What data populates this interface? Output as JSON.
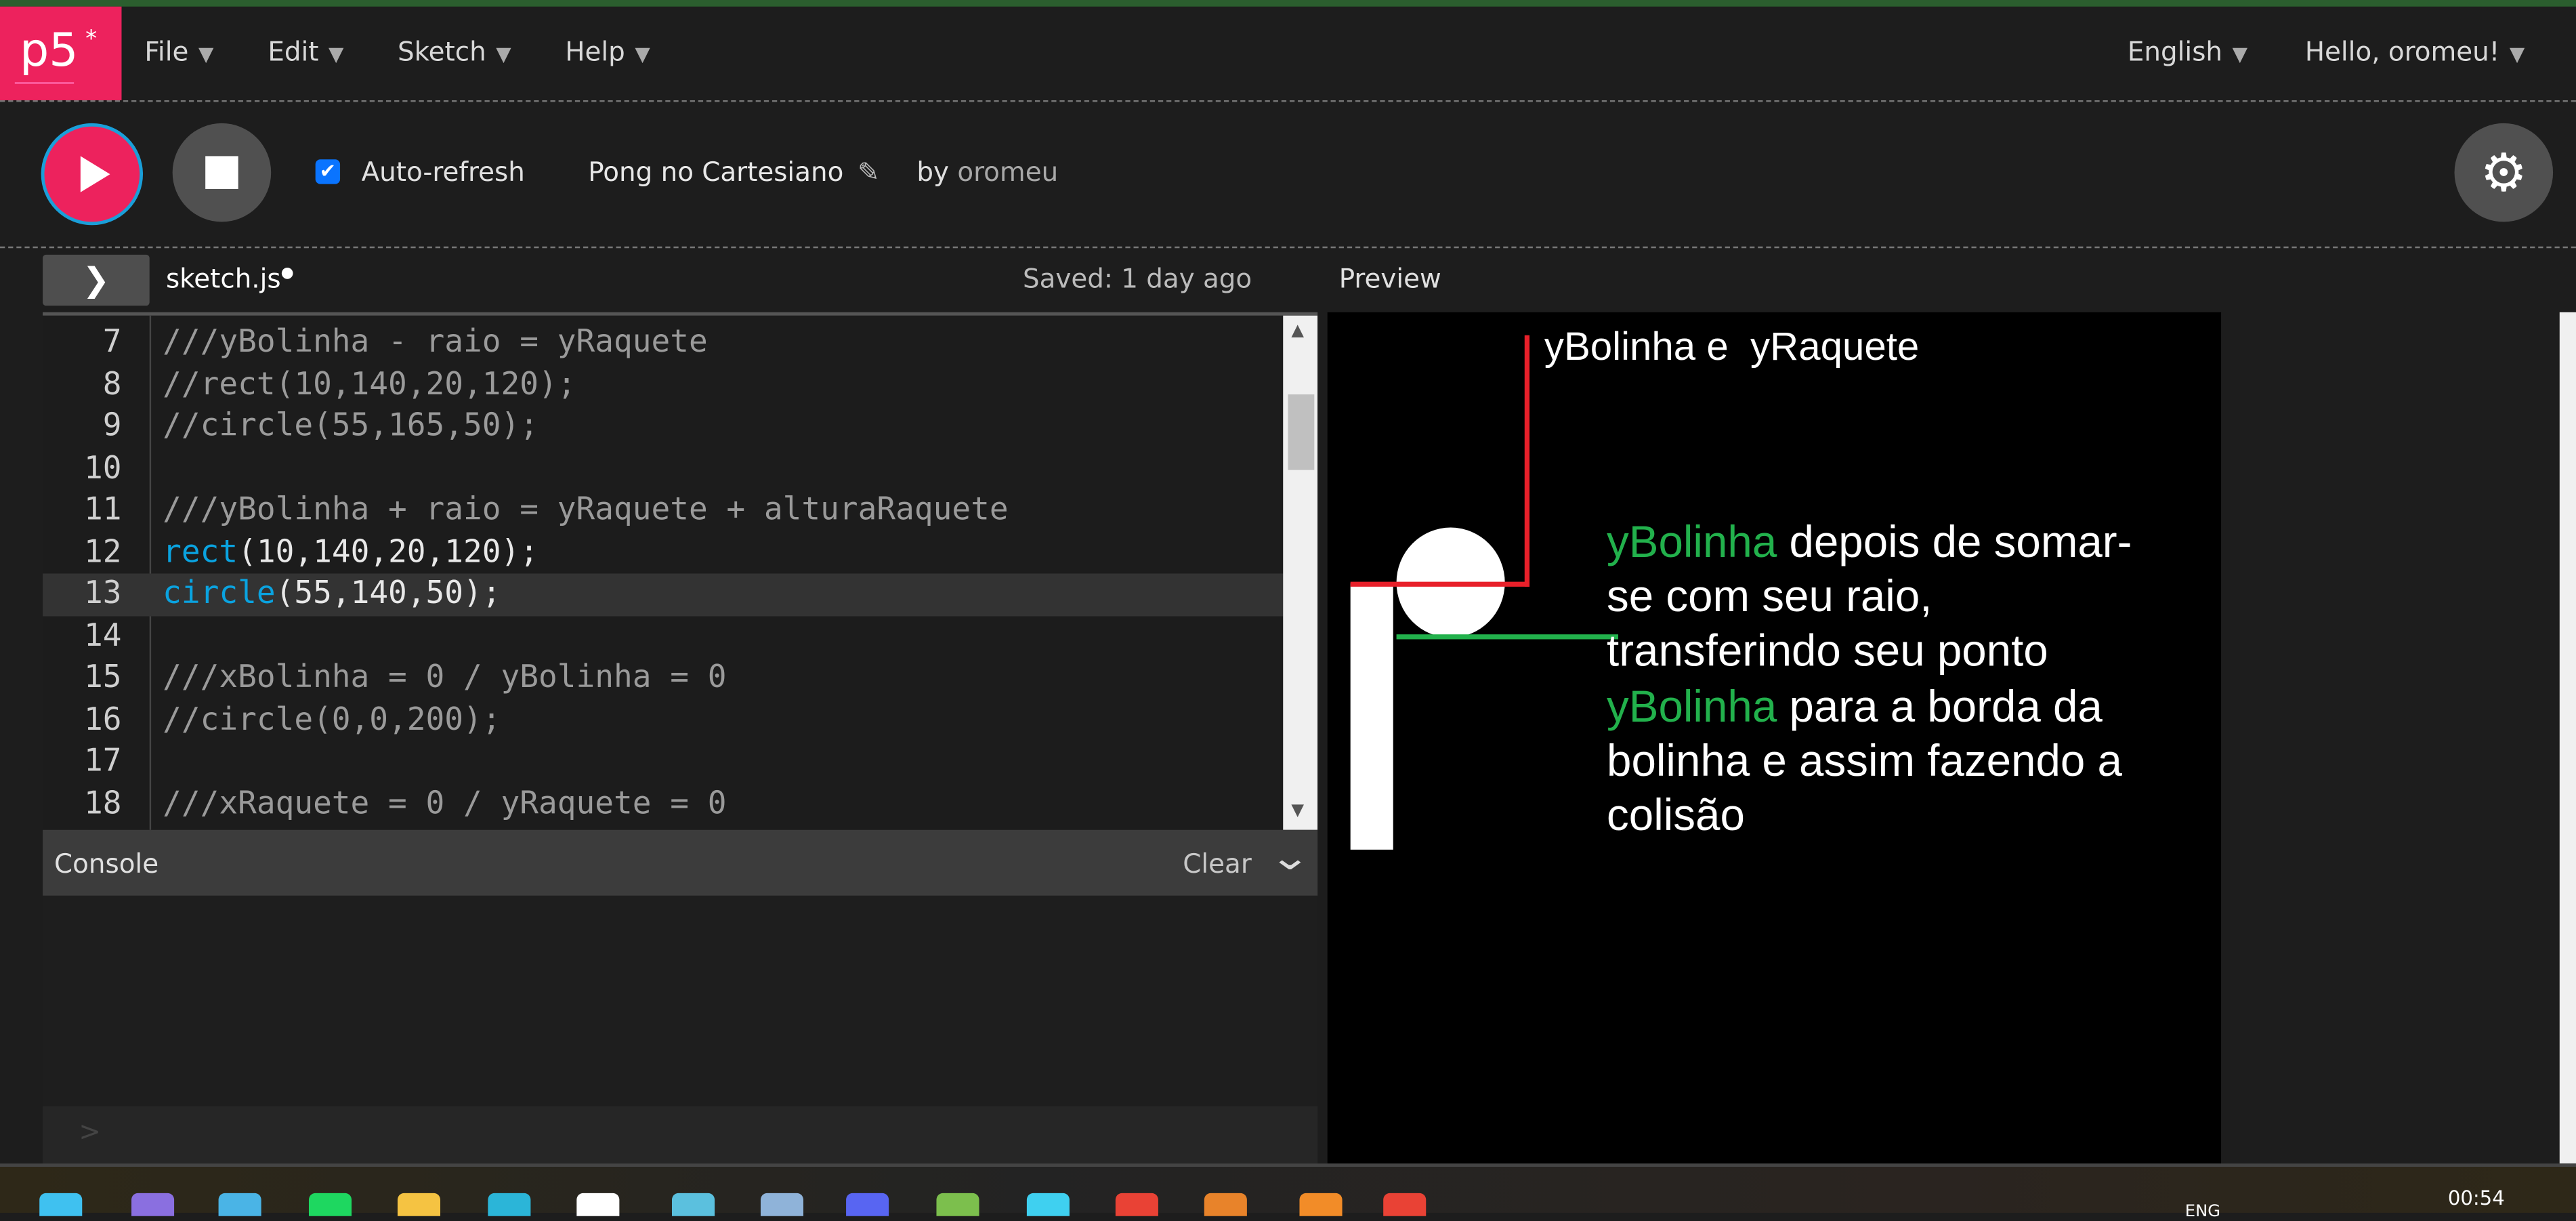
{
  "app": {
    "logo": "p5",
    "logo_mark": "*",
    "accent": "#ed225d"
  },
  "menu": {
    "items": [
      {
        "label": "File"
      },
      {
        "label": "Edit"
      },
      {
        "label": "Sketch"
      },
      {
        "label": "Help"
      }
    ],
    "language": "English",
    "user": "Hello, oromeu!"
  },
  "toolbar": {
    "auto_refresh_label": "Auto-refresh",
    "auto_refresh_checked": true,
    "sketch_title": "Pong no Cartesiano",
    "by_label": "by",
    "author": "oromeu"
  },
  "editor": {
    "file_tab": "sketch.js",
    "unsaved_dot": "●",
    "saved_status": "Saved: 1 day ago",
    "active_line": 13,
    "lines": [
      {
        "n": "7",
        "text": "///yBolinha - raio = yRaquete"
      },
      {
        "n": "8",
        "text": "//rect(10,140,20,120);"
      },
      {
        "n": "9",
        "text": "//circle(55,165,50);"
      },
      {
        "n": "10",
        "text": ""
      },
      {
        "n": "11",
        "text": "///yBolinha + raio = yRaquete + alturaRaquete"
      },
      {
        "n": "12",
        "kw": "rect",
        "text": "(10,140,20,120);"
      },
      {
        "n": "13",
        "kw": "circle",
        "text": "(55,140,50);"
      },
      {
        "n": "14",
        "text": ""
      },
      {
        "n": "15",
        "text": "///xBolinha = 0 / yBolinha = 0"
      },
      {
        "n": "16",
        "text": "//circle(0,0,200);"
      },
      {
        "n": "17",
        "text": ""
      },
      {
        "n": "18",
        "text": "///xRaquete = 0 / yRaquete = 0"
      }
    ]
  },
  "console": {
    "title": "Console",
    "clear_label": "Clear",
    "prompt": ">"
  },
  "preview": {
    "label": "Preview",
    "top_text": "yBolinha e  yRaquete",
    "paragraph_lines": [
      [
        {
          "t": "yBolinha",
          "green": true
        },
        {
          "t": " depois de somar-"
        }
      ],
      [
        {
          "t": "se com seu raio,"
        }
      ],
      [
        {
          "t": "transferindo seu ponto"
        }
      ],
      [
        {
          "t": "yBolinha",
          "green": true
        },
        {
          "t": " para a borda da"
        }
      ],
      [
        {
          "t": "bolinha e assim fazendo a"
        }
      ],
      [
        {
          "t": "colisão"
        }
      ]
    ],
    "colors": {
      "red": "#e8202a",
      "green": "#22b14c",
      "text": "#ffffff"
    }
  },
  "taskbar": {
    "time": "00:54",
    "lang": "ENG"
  }
}
